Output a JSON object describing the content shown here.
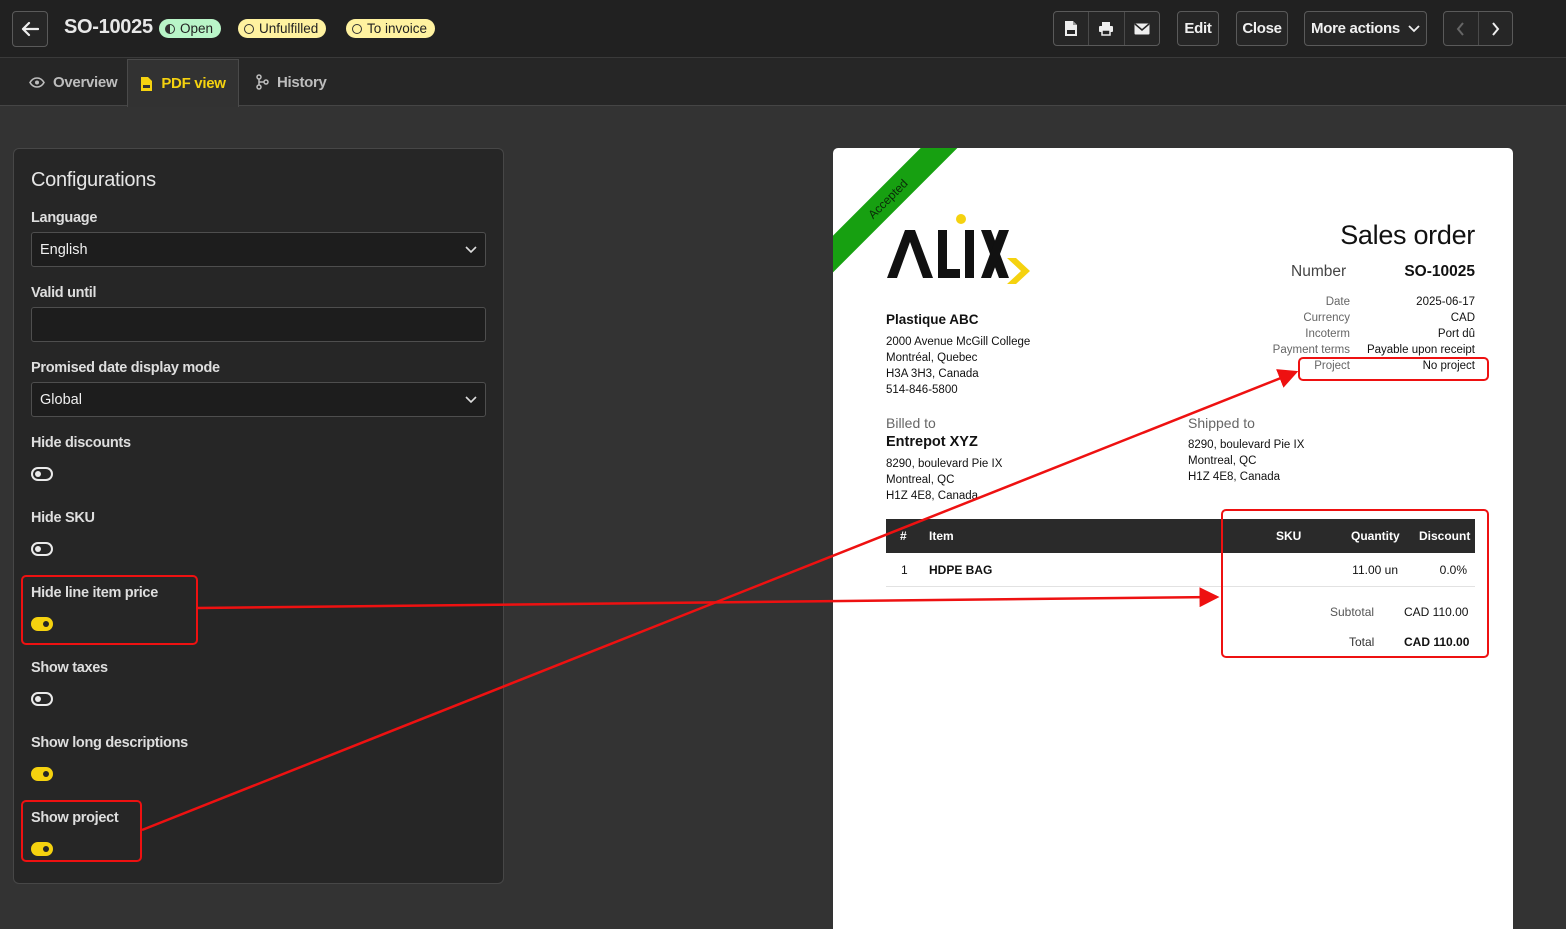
{
  "header": {
    "title": "SO-10025",
    "badges": {
      "open": "Open",
      "unfulfilled": "Unfulfilled",
      "to_invoice": "To invoice"
    },
    "buttons": {
      "edit": "Edit",
      "close": "Close",
      "more_actions": "More actions"
    }
  },
  "tabs": {
    "overview": "Overview",
    "pdf_view": "PDF view",
    "history": "History"
  },
  "config": {
    "title": "Configurations",
    "language_label": "Language",
    "language_value": "English",
    "valid_until_label": "Valid until",
    "valid_until_value": "",
    "promised_label": "Promised date display mode",
    "promised_value": "Global",
    "toggles": [
      {
        "label": "Hide discounts",
        "on": false
      },
      {
        "label": "Hide SKU",
        "on": false
      },
      {
        "label": "Hide line item price",
        "on": true
      },
      {
        "label": "Show taxes",
        "on": false
      },
      {
        "label": "Show long descriptions",
        "on": true
      },
      {
        "label": "Show project",
        "on": true
      }
    ]
  },
  "doc": {
    "ribbon": "Accepted",
    "title": "Sales order",
    "number_label": "Number",
    "number_value": "SO-10025",
    "meta": [
      {
        "k": "Date",
        "v": "2025-06-17"
      },
      {
        "k": "Currency",
        "v": "CAD"
      },
      {
        "k": "Incoterm",
        "v": "Port dû"
      },
      {
        "k": "Payment terms",
        "v": "Payable upon receipt"
      },
      {
        "k": "Project",
        "v": "No project"
      }
    ],
    "company": {
      "name": "Plastique ABC",
      "lines": [
        "2000 Avenue McGill College",
        "Montréal, Quebec",
        "H3A 3H3, Canada",
        "514-846-5800"
      ]
    },
    "billed": {
      "label": "Billed to",
      "name": "Entrepot XYZ",
      "lines": [
        "8290, boulevard Pie IX",
        "Montreal, QC",
        "H1Z 4E8, Canada"
      ]
    },
    "shipped": {
      "label": "Shipped to",
      "lines": [
        "8290, boulevard Pie IX",
        "Montreal, QC",
        "H1Z 4E8, Canada"
      ]
    },
    "table": {
      "headers": {
        "num": "#",
        "item": "Item",
        "sku": "SKU",
        "qty": "Quantity",
        "discount": "Discount"
      },
      "rows": [
        {
          "num": "1",
          "item": "HDPE BAG",
          "sku": "",
          "qty": "11.00 un",
          "discount": "0.0%"
        }
      ]
    },
    "subtotal_label": "Subtotal",
    "subtotal_value": "CAD 110.00",
    "total_label": "Total",
    "total_value": "CAD 110.00"
  },
  "colors": {
    "accent": "#f5d20f",
    "annotation": "#ee1111",
    "ribbon": "#17a011"
  }
}
